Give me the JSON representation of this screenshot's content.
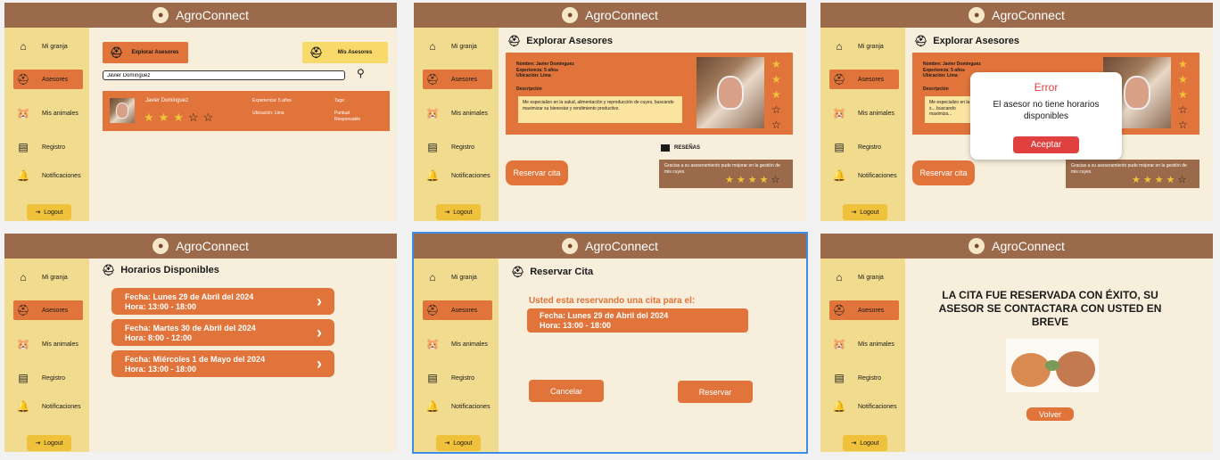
{
  "app": {
    "title": "AgroConnect",
    "logo_icon": "hamster-logo-icon"
  },
  "colors": {
    "topbar": "#9b6a4a",
    "sidebar": "#f0db8e",
    "accent": "#e0743a",
    "background": "#f7eedb",
    "star": "#f0c23c",
    "error": "#e0413f"
  },
  "sidebar": {
    "items": [
      {
        "label": "Mi granja",
        "icon": "barn-icon"
      },
      {
        "label": "Asesores",
        "icon": "advisor-hat-icon"
      },
      {
        "label": "Mis animales",
        "icon": "hamster-icon"
      },
      {
        "label": "Registro",
        "icon": "clipboard-icon"
      },
      {
        "label": "Notificaciones",
        "icon": "bell-icon"
      }
    ],
    "logout": "Logout"
  },
  "screen1": {
    "explore_button": "Explorar Asesores",
    "my_advisors_button": "Mis Asesores",
    "search_value": "Javier Domínguez",
    "result": {
      "name": "Javier Dominguez",
      "experience": "Experiencia: 5 años",
      "location": "Ubicación: Lima",
      "tags_label": "Tags:",
      "tags": "Puntual\nResponsable",
      "rating": 3
    }
  },
  "screen2": {
    "heading": "Explorar Asesores",
    "profile": {
      "name": "Nombre: Javier Dominguez",
      "experience": "Experiencia: 5 años",
      "location": "Ubicación: Lima",
      "desc_label": "Descripción",
      "description": "Me especializo en la salud, alimentación y reproducción de cuyes, buscando maximizar su bienestar y rendimiento productivo.",
      "rating": 3
    },
    "reserve_button": "Reservar cita",
    "reviews_label": "RESEÑAS",
    "review": {
      "text": "Gracias a su asesoramiento pude mejorar en la gestión de mis cuyes.",
      "rating": 4
    }
  },
  "screen3": {
    "heading": "Explorar Asesores",
    "profile_short": {
      "name": "Nombre: Javier Dominguez",
      "experience": "Experiencia: 5 años",
      "location": "Ubicación: Lima",
      "desc_label": "Descripción",
      "description": "Me especializo en la s... buscando maximiza..."
    },
    "reserve_button": "Reservar cita",
    "review_text": "Gracias a su asesoramiento pude mejorar en la gestión de mis cuyes.",
    "modal": {
      "title": "Error",
      "message": "El asesor no tiene horarios disponibles",
      "button": "Aceptar"
    }
  },
  "screen4": {
    "heading": "Horarios Disponibles",
    "slots": [
      {
        "date": "Fecha: Lunes 29 de Abril del 2024",
        "time": "Hora: 13:00 - 18:00"
      },
      {
        "date": "Fecha: Martes 30 de Abril del 2024",
        "time": "Hora: 8:00 - 12:00"
      },
      {
        "date": "Fecha: Miércoles 1 de Mayo del 2024",
        "time": "Hora: 13:00 - 18:00"
      }
    ]
  },
  "screen5": {
    "heading": "Reservar Cita",
    "subtitle": "Usted esta reservando una cita para el:",
    "slot": {
      "date": "Fecha: Lunes 29 de Abril del 2024",
      "time": "Hora: 13:00 - 18:00"
    },
    "cancel": "Cancelar",
    "reserve": "Reservar"
  },
  "screen6": {
    "message": "LA CITA FUE RESERVADA CON ÉXITO, SU ASESOR SE CONTACTARA CON USTED EN BREVE",
    "back": "Volver"
  }
}
